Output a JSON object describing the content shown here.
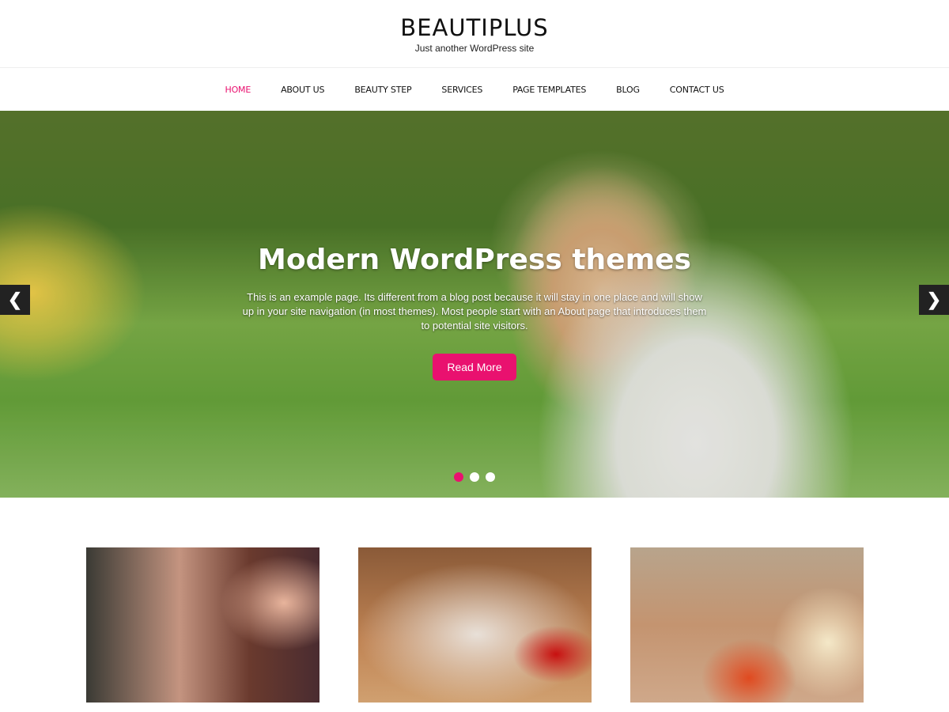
{
  "site": {
    "title": "BEAUTIPLUS",
    "tagline": "Just another WordPress site"
  },
  "nav": [
    {
      "label": "HOME",
      "active": true
    },
    {
      "label": "ABOUT US"
    },
    {
      "label": "BEAUTY STEP"
    },
    {
      "label": "SERVICES"
    },
    {
      "label": "PAGE TEMPLATES"
    },
    {
      "label": "BLOG"
    },
    {
      "label": "CONTACT US"
    }
  ],
  "slider": {
    "heading": "Modern WordPress themes",
    "text": "This is an example page. Its different from a blog post because it will stay in one place and will show up in your site navigation (in most themes). Most people start with an About page that introduces them to potential site visitors.",
    "button": "Read More",
    "prev_icon": "chevron-left",
    "next_icon": "chevron-right",
    "arrow_prev": "❮",
    "arrow_next": "❯",
    "slide_count": 3,
    "active_slide": 1
  },
  "colors": {
    "accent": "#e9116f"
  }
}
